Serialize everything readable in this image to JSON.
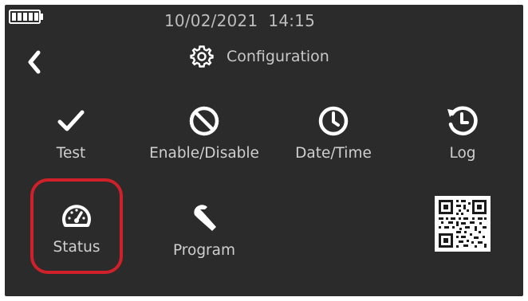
{
  "status_bar": {
    "battery_icon": "battery-full-icon",
    "datetime": "10/02/2021  14:15"
  },
  "header": {
    "back_icon": "chevron-left-icon",
    "title_icon": "gear-icon",
    "title": "Configuration"
  },
  "menu": {
    "items": [
      {
        "label": "Test",
        "icon": "checkmark-icon"
      },
      {
        "label": "Enable/Disable",
        "icon": "prohibit-icon"
      },
      {
        "label": "Date/Time",
        "icon": "clock-icon"
      },
      {
        "label": "Log",
        "icon": "history-clock-icon"
      },
      {
        "label": "Status",
        "icon": "speedometer-icon",
        "highlighted": true
      },
      {
        "label": "Program",
        "icon": "wrench-icon"
      },
      {
        "label": "",
        "icon": "qr-code-icon"
      }
    ]
  },
  "colors": {
    "screen_bg": "#2b2b2b",
    "text": "#d9d9d9",
    "highlight": "#d0202a"
  }
}
